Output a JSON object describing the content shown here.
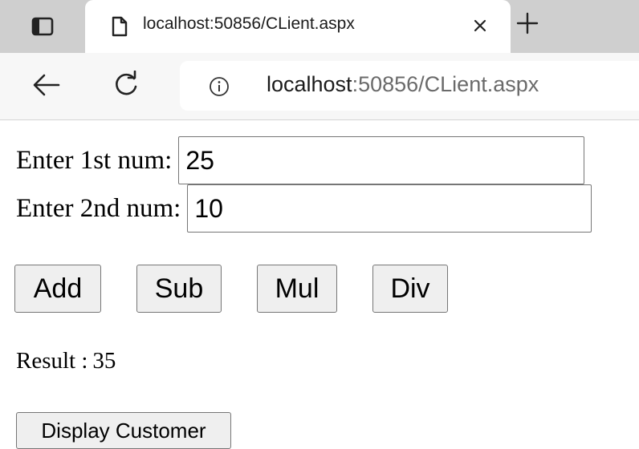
{
  "browser": {
    "tab": {
      "title": "localhost:50856/CLient.aspx",
      "icons": [
        "window-icon",
        "document-icon",
        "close-icon",
        "plus-icon"
      ]
    },
    "toolbar": {
      "icons": [
        "back-arrow-icon",
        "reload-icon",
        "info-icon"
      ]
    },
    "address": {
      "host": "localhost",
      "rest": ":50856/CLient.aspx"
    }
  },
  "form": {
    "num1": {
      "label": "Enter 1st num:",
      "value": "25"
    },
    "num2": {
      "label": "Enter 2nd num:",
      "value": "10"
    },
    "buttons": {
      "add": "Add",
      "sub": "Sub",
      "mul": "Mul",
      "div": "Div"
    },
    "result": {
      "label": "Result :",
      "value": "35"
    },
    "display_customer": "Display Customer"
  }
}
